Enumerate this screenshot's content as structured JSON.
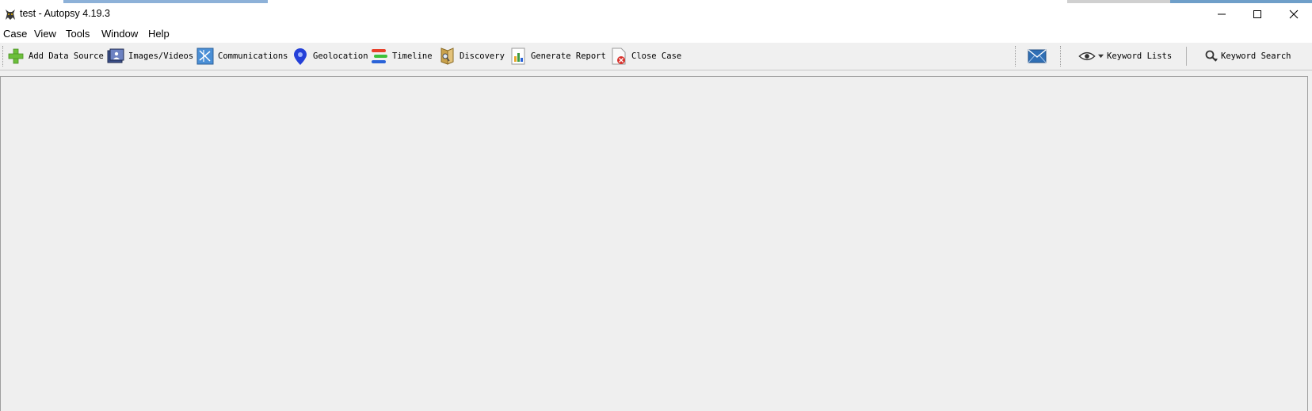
{
  "window": {
    "title": "test - Autopsy 4.19.3",
    "controls": {
      "minimize": "minimize-icon",
      "maximize": "maximize-icon",
      "close": "close-icon"
    }
  },
  "menu": {
    "items": [
      "Case",
      "View",
      "Tools",
      "Window",
      "Help"
    ]
  },
  "toolbar": {
    "add_data_source": "Add Data Source",
    "images_videos": "Images/Videos",
    "communications": "Communications",
    "geolocation": "Geolocation",
    "timeline": "Timeline",
    "discovery": "Discovery",
    "generate_report": "Generate Report",
    "close_case": "Close Case",
    "keyword_lists": "Keyword Lists",
    "keyword_search": "Keyword Search"
  },
  "colors": {
    "accent_blue": "#2f6fb5",
    "add_green": "#6cbf3b",
    "close_red": "#d9312b",
    "geo_blue": "#2440d8",
    "topstrip_blue": "#6f9fc9"
  }
}
